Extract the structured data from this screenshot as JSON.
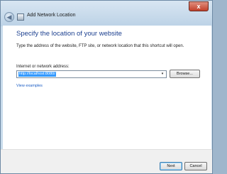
{
  "window": {
    "title": "Add Network Location",
    "close_label": "x",
    "back_glyph": "◀"
  },
  "page": {
    "heading": "Specify the location of your website",
    "description": "Type the address of the website, FTP site, or network location that this shortcut will open."
  },
  "address": {
    "label": "Internet or network address:",
    "value": "http://localhost:8080/",
    "dropdown_glyph": "▾",
    "browse_label": "Browse..."
  },
  "links": {
    "view_examples": "View examples"
  },
  "footer": {
    "next_label": "Next",
    "cancel_label": "Cancel"
  }
}
